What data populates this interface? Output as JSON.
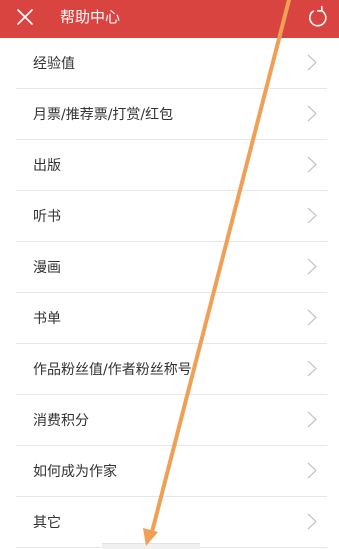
{
  "header": {
    "title": "帮助中心",
    "close_icon": "close-icon",
    "refresh_icon": "refresh-icon",
    "background_color": "#d94441"
  },
  "menu": {
    "items": [
      {
        "label": "经验值"
      },
      {
        "label": "月票/推荐票/打赏/红包"
      },
      {
        "label": "出版"
      },
      {
        "label": "听书"
      },
      {
        "label": "漫画"
      },
      {
        "label": "书单"
      },
      {
        "label": "作品粉丝值/作者粉丝称号"
      },
      {
        "label": "消费积分"
      },
      {
        "label": "如何成为作家"
      },
      {
        "label": "其它"
      }
    ],
    "chevron_icon": "chevron-right-icon"
  },
  "overlay": {
    "arrow_color": "#f0a055"
  }
}
